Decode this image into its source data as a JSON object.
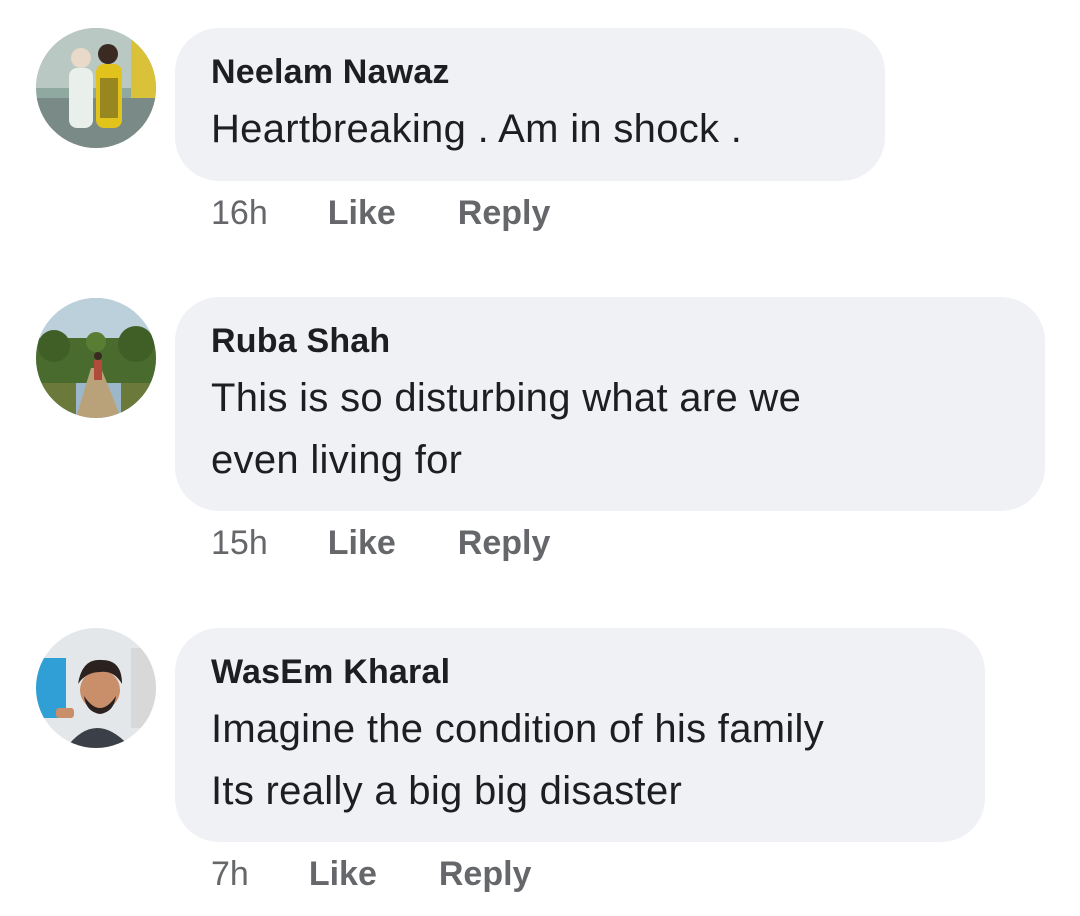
{
  "comments": [
    {
      "author": "Neelam Nawaz",
      "lines": [
        "Heartbreaking . Am in shock ."
      ],
      "time": "16h",
      "like_label": "Like",
      "reply_label": "Reply"
    },
    {
      "author": "Ruba Shah",
      "lines": [
        "This is so disturbing what are we",
        "even living for"
      ],
      "time": "15h",
      "like_label": "Like",
      "reply_label": "Reply"
    },
    {
      "author": "WasEm Kharal",
      "lines": [
        "Imagine the condition of his family",
        "Its really a big big disaster"
      ],
      "time": "7h",
      "like_label": "Like",
      "reply_label": "Reply"
    }
  ],
  "colors": {
    "bubble_bg": "#f0f1f5",
    "text": "#1c1e21",
    "meta": "#65676b"
  }
}
